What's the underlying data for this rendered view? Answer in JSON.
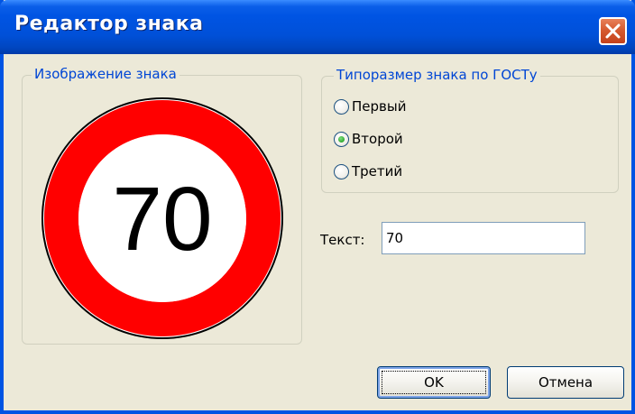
{
  "window": {
    "title": "Редактор знака",
    "close_icon": "close-icon"
  },
  "preview": {
    "legend": "Изображение знака",
    "sign_text": "70",
    "colors": {
      "ring": "#ff0000",
      "face": "#ffffff",
      "text": "#000000"
    }
  },
  "size_group": {
    "legend": "Типоразмер знака по ГОСТу",
    "options": [
      {
        "label": "Первый",
        "checked": false
      },
      {
        "label": "Второй",
        "checked": true
      },
      {
        "label": "Третий",
        "checked": false
      }
    ]
  },
  "text_field": {
    "label": "Текст:",
    "value": "70"
  },
  "buttons": {
    "ok": "OK",
    "cancel": "Отмена"
  }
}
